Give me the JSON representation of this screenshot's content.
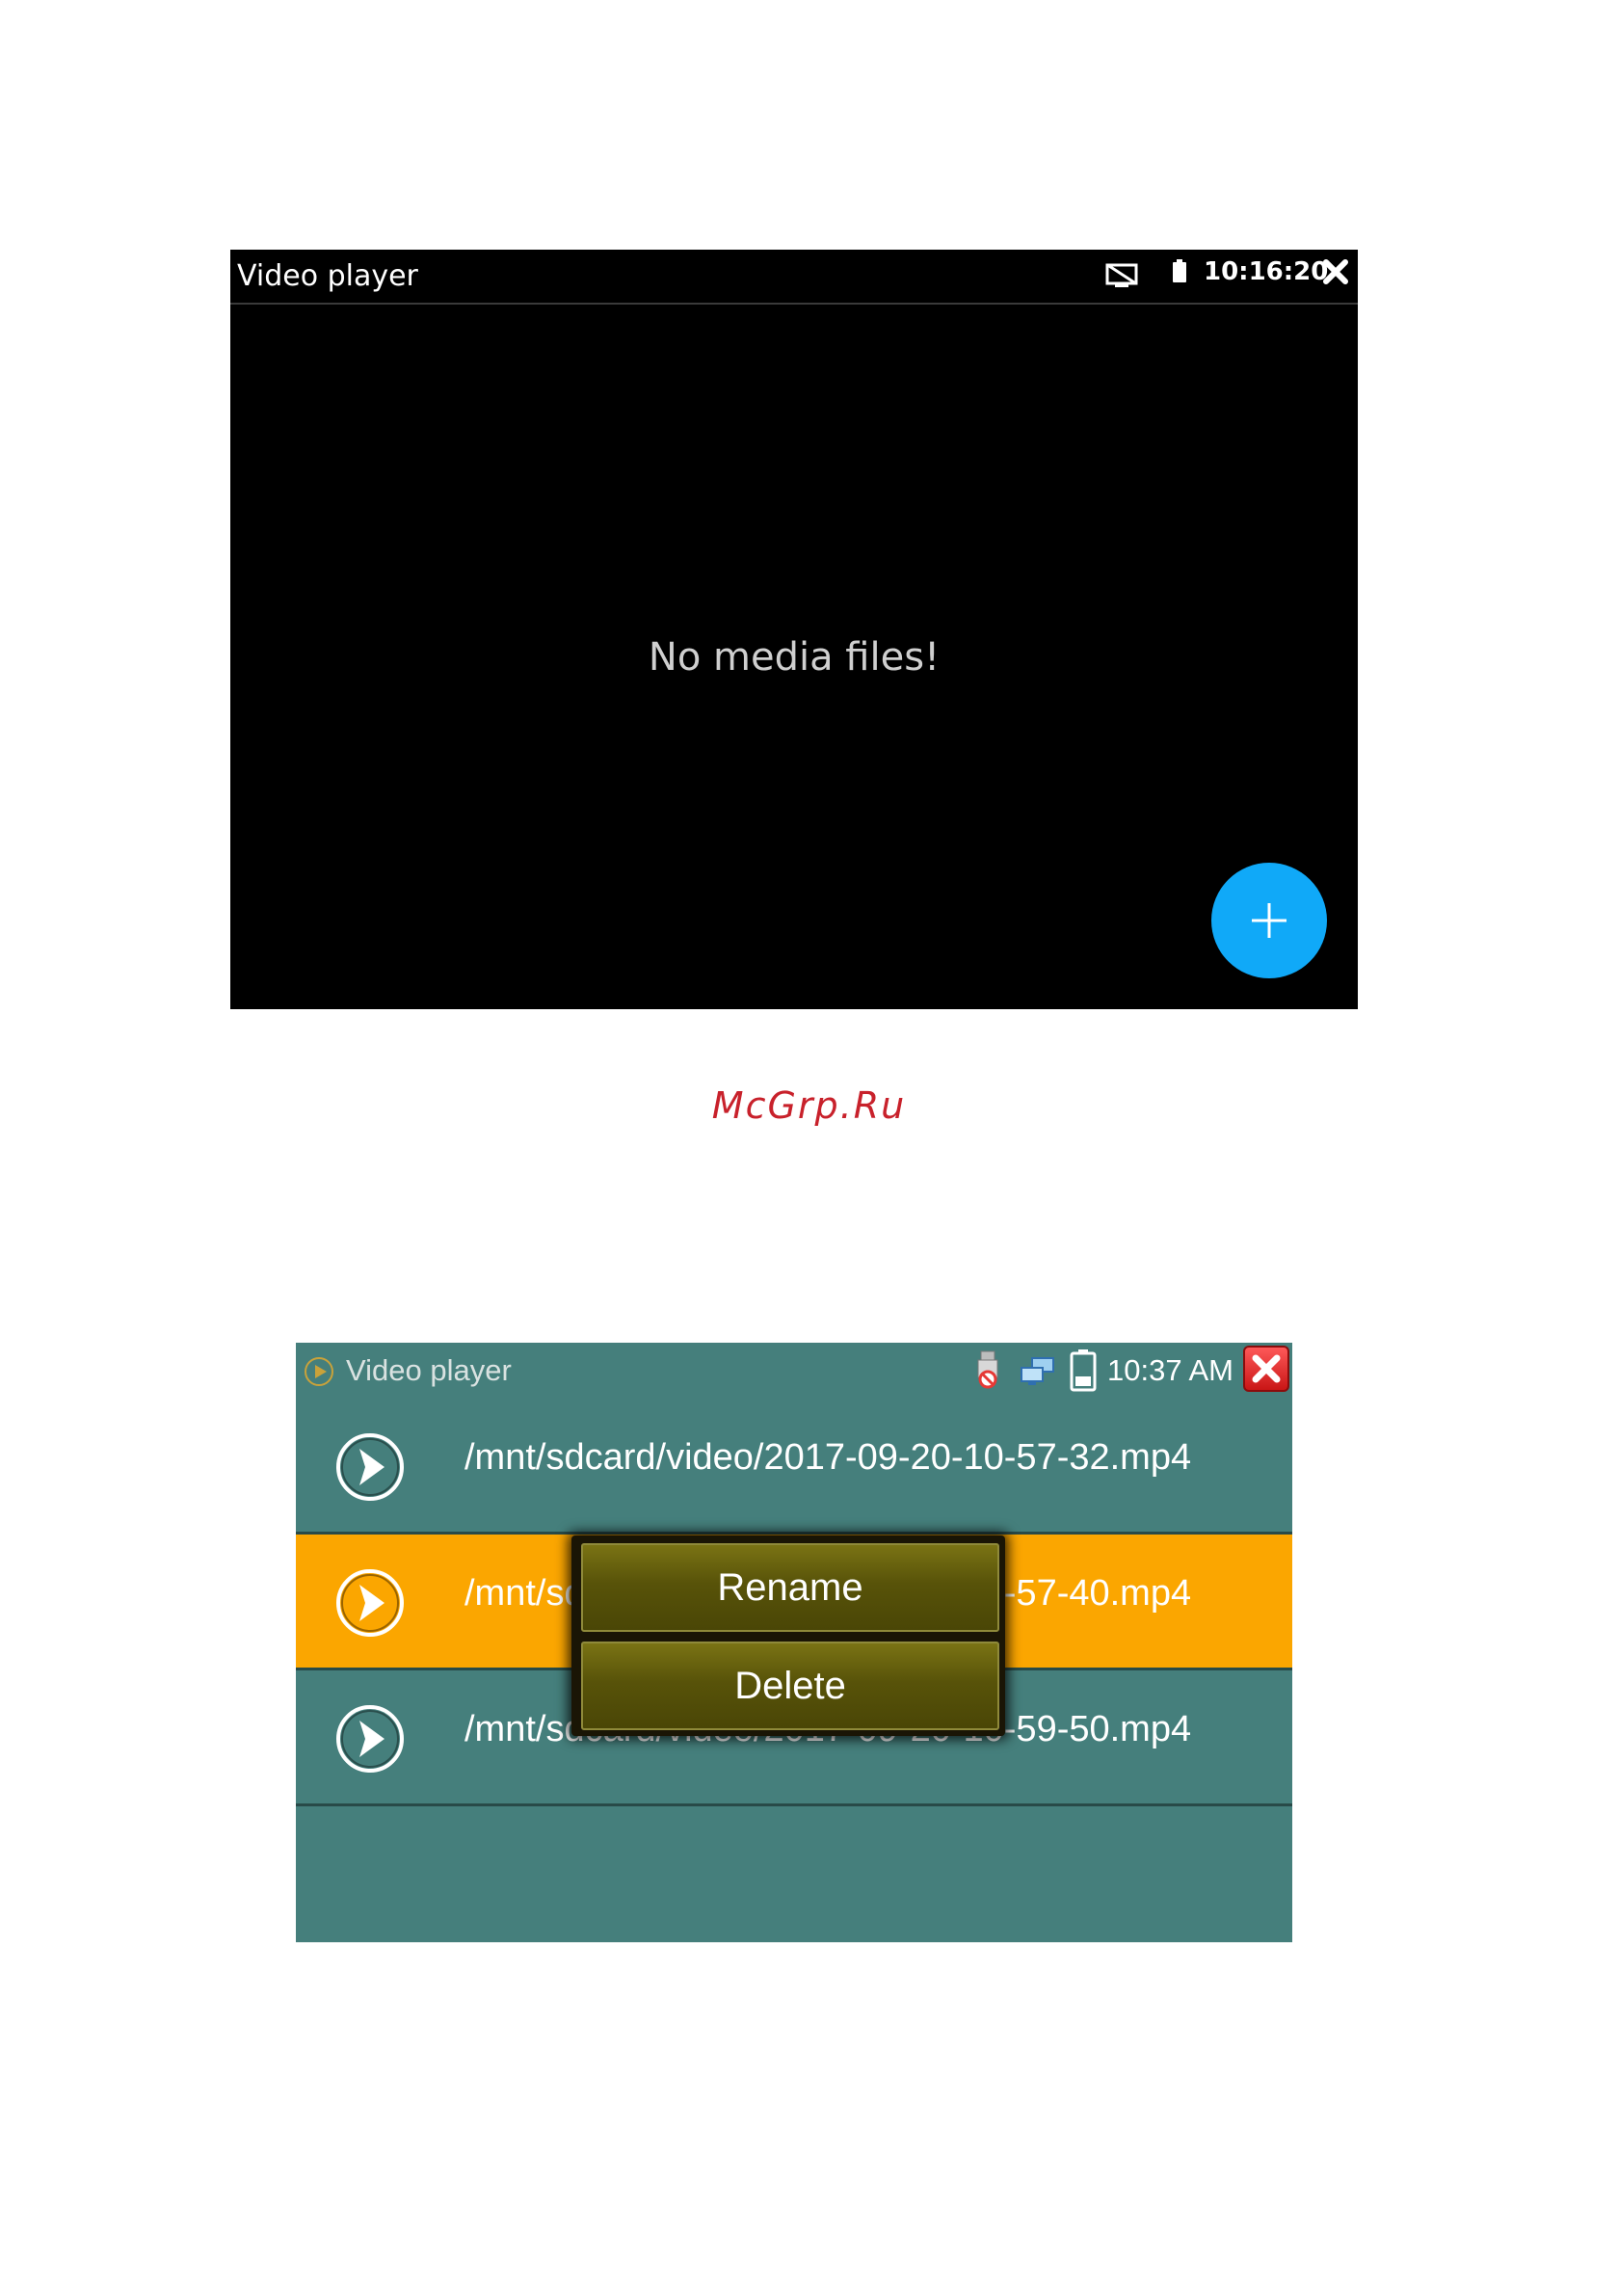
{
  "screen1": {
    "title": "Video player",
    "time": "10:16:20",
    "empty_message": "No media files!",
    "icons": {
      "cast": "screen-cast-off-icon",
      "battery": "battery-icon",
      "close": "close-icon",
      "add": "plus-icon"
    },
    "fab_color": "#10a9f8"
  },
  "watermark": "McGrp.Ru",
  "screen2": {
    "title": "Video player",
    "time": "10:37 AM",
    "icons": {
      "app": "play-circle-icon",
      "usb": "usb-disconnected-icon",
      "network": "network-icon",
      "battery": "battery-icon",
      "close": "close-icon"
    },
    "files": [
      {
        "path": "/mnt/sdcard/video/2017-09-20-10-57-32.mp4",
        "selected": false
      },
      {
        "path": "/mnt/sdcard/video/2017-09-20-10-57-40.mp4",
        "selected": true
      },
      {
        "path": "/mnt/sdcard/video/2017-09-20-10-59-50.mp4",
        "selected": false
      }
    ],
    "context_menu": {
      "rename_label": "Rename",
      "delete_label": "Delete"
    },
    "colors": {
      "background": "#457f7c",
      "selected_row": "#fba600"
    }
  }
}
